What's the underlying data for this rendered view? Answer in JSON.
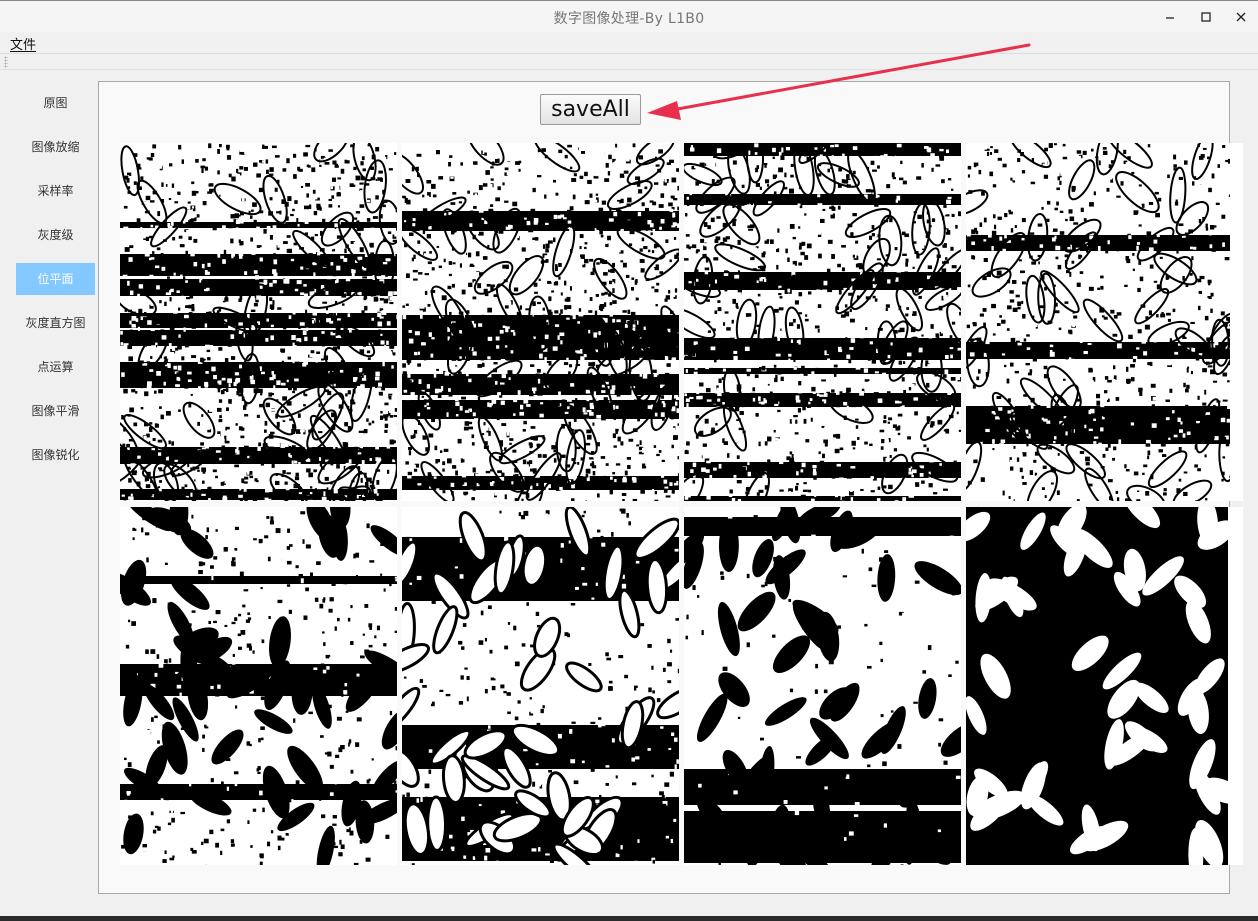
{
  "window": {
    "title": "数字图像处理-By L1B0"
  },
  "menu": {
    "file_label": "文件"
  },
  "sidebar": {
    "items": [
      {
        "label": "原图"
      },
      {
        "label": "图像放缩"
      },
      {
        "label": "采样率"
      },
      {
        "label": "灰度级"
      },
      {
        "label": "位平面"
      },
      {
        "label": "灰度直方图"
      },
      {
        "label": "点运算"
      },
      {
        "label": "图像平滑"
      },
      {
        "label": "图像锐化"
      }
    ],
    "active_label": "位平面"
  },
  "toolbar": {
    "save_all_label": "saveAll"
  },
  "bitplanes": {
    "count": 8,
    "tiles": [
      {
        "bit": 0,
        "noise": 0.95,
        "grain_black": false
      },
      {
        "bit": 1,
        "noise": 0.9,
        "grain_black": false
      },
      {
        "bit": 2,
        "noise": 0.75,
        "grain_black": false
      },
      {
        "bit": 3,
        "noise": 0.6,
        "grain_black": false
      },
      {
        "bit": 4,
        "noise": 0.35,
        "grain_black": true
      },
      {
        "bit": 5,
        "noise": 0.25,
        "grain_black": false
      },
      {
        "bit": 6,
        "noise": 0.1,
        "grain_black": true
      },
      {
        "bit": 7,
        "noise": 0.0,
        "grain_black": false
      }
    ]
  },
  "colors": {
    "active_nav": "#83c8ff",
    "annotation_arrow": "#e8304e"
  },
  "icons": [
    "minimize-icon",
    "maximize-icon",
    "close-icon",
    "toolbar-grip-icon"
  ]
}
